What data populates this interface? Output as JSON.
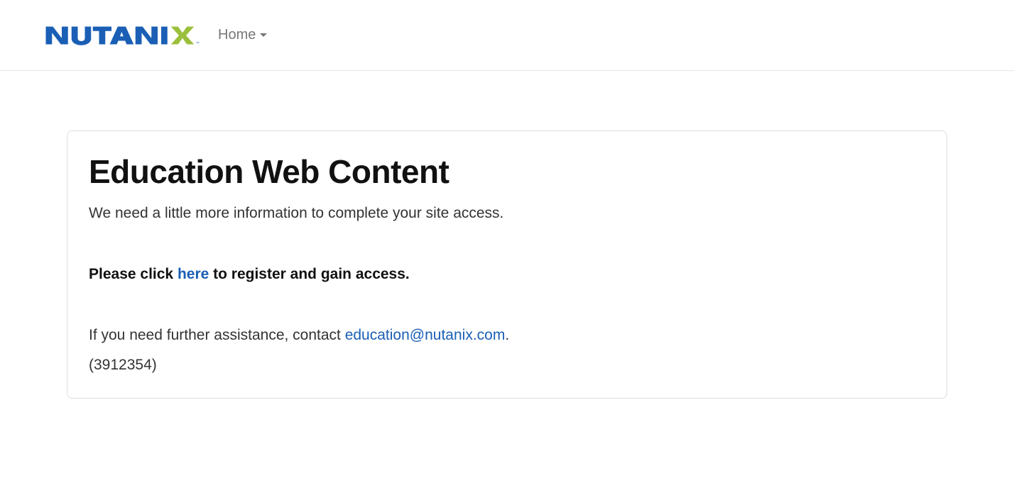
{
  "nav": {
    "home_label": "Home"
  },
  "panel": {
    "title": "Education Web Content",
    "subtitle": "We need a little more information to complete your site access.",
    "register_prefix": "Please click ",
    "register_link": "here",
    "register_suffix": " to register and gain access.",
    "assist_prefix": "If you need further assistance, contact ",
    "assist_email": "education@nutanix.com",
    "assist_suffix": ".",
    "reference_id": "(3912354)"
  }
}
